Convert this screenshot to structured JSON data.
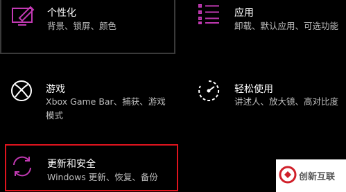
{
  "colors": {
    "accent": "#c239b3",
    "selected_border": "#e0141e",
    "background": "#000000"
  },
  "tiles": {
    "personalization": {
      "title": "个性化",
      "description": "背景、锁屏、颜色",
      "icon": "personalization-icon"
    },
    "apps": {
      "title": "应用",
      "description": "卸载、默认应用、可选功能",
      "icon": "apps-list-icon"
    },
    "gaming": {
      "title": "游戏",
      "description": "Xbox Game Bar、捕获、游戏模式",
      "icon": "xbox-icon"
    },
    "ease": {
      "title": "轻松使用",
      "description": "讲述人、放大镜、高对比度",
      "icon": "ease-of-access-icon"
    },
    "update": {
      "title": "更新和安全",
      "description": "Windows 更新、恢复、备份",
      "icon": "sync-icon"
    }
  },
  "watermark": {
    "text": "创新互联"
  }
}
